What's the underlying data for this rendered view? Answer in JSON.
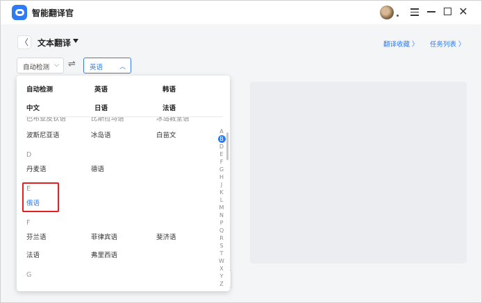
{
  "app": {
    "title": "智能翻译官"
  },
  "header": {
    "title": "文本翻译",
    "links": {
      "favorites": "翻译收藏 〉",
      "tasks": "任务列表 〉"
    }
  },
  "selectors": {
    "source": "自动检测",
    "target": "英语"
  },
  "dropdown": {
    "fixed": [
      [
        "自动检测",
        "英语",
        "韩语"
      ],
      [
        "中文",
        "日语",
        "法语"
      ]
    ],
    "cut_row": [
      "巴布亚皮钦语",
      "比斯拉马语",
      "冰岛教堂语"
    ],
    "rows": [
      {
        "items": [
          "波斯尼亚语",
          "冰岛语",
          "白苗文"
        ]
      },
      {
        "letter": "D",
        "items": [
          "丹麦语",
          "德语"
        ]
      },
      {
        "letter": "E",
        "items": [
          "俄语"
        ],
        "selected": "俄语"
      },
      {
        "letter": "F",
        "items": [
          "芬兰语",
          "菲律宾语",
          "斐济语"
        ]
      },
      {
        "items": [
          "法语",
          "弗里西语"
        ]
      },
      {
        "letter": "G",
        "items": []
      }
    ],
    "alphabet": [
      "A",
      "B",
      "D",
      "E",
      "F",
      "G",
      "H",
      "J",
      "K",
      "L",
      "M",
      "N",
      "P",
      "Q",
      "R",
      "S",
      "T",
      "W",
      "X",
      "Y",
      "Z"
    ],
    "active_letter": "B"
  },
  "colors": {
    "accent": "#2f7bf6",
    "highlight": "#e02020"
  }
}
